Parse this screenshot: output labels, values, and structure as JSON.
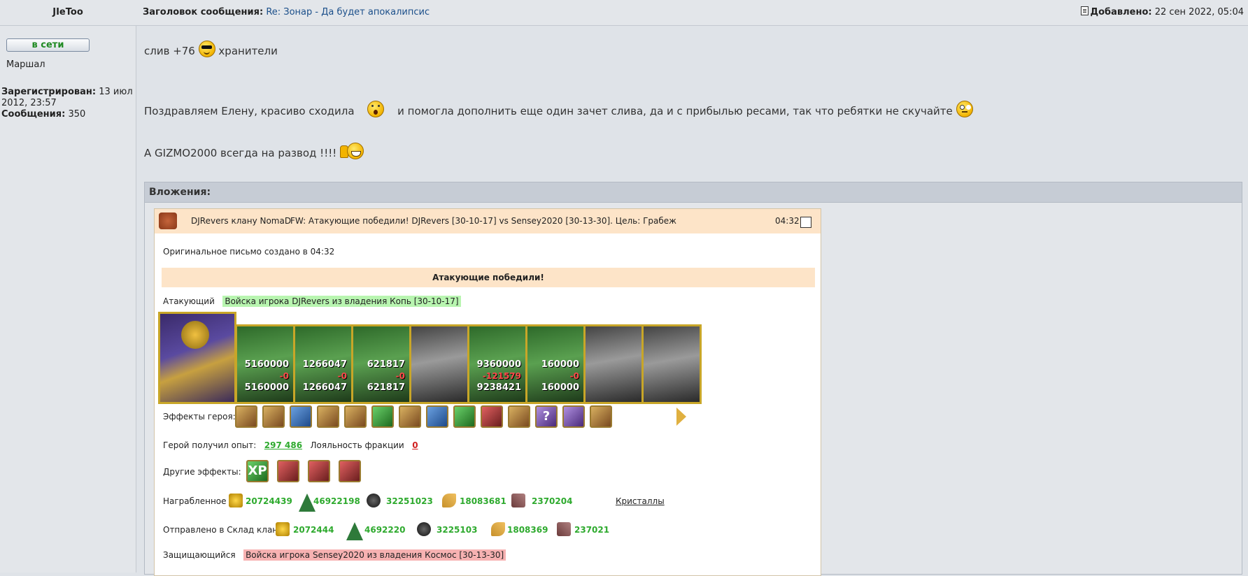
{
  "header": {
    "author": "JIeToo",
    "subject_label": "Заголовок сообщения:",
    "subject": "Re: Зонар - Да будет апокалипсис",
    "added_label": "Добавлено:",
    "added_value": "22 сен 2022, 05:04"
  },
  "sidebar": {
    "online": "в сети",
    "rank": "Маршал",
    "registered_label": "Зарегистрирован:",
    "registered_value": "13 июл 2012, 23:57",
    "posts_label": "Сообщения:",
    "posts_value": "350"
  },
  "post": {
    "line1_a": "слив +76",
    "line1_b": "хранители",
    "line2_a": "Поздравляем Елену, красиво сходила",
    "line2_b": "и помогла дополнить еще один зачет слива, да и с прибылью ресами, так что ребятки не скучайте",
    "line3": "А GIZMO2000 всегда на развод !!!!"
  },
  "attachments": {
    "title": "Вложения:",
    "mail": {
      "from": "DJRevers клану NomaD",
      "subject": "FW: Атакующие победили! DJRevers [30-10-17] vs Sensey2020 [30-13-30]. Цель: Грабеж",
      "time": "04:32",
      "original": "Оригинальное письмо создано в 04:32",
      "banner": "Атакующие победили!",
      "attacker_label": "Атакующий",
      "attacker_value": "Войска игрока DJRevers из владения Копь [30-10-17]",
      "units": [
        {
          "n1": "5160000",
          "n2": "-0",
          "n3": "5160000"
        },
        {
          "n1": "1266047",
          "n2": "-0",
          "n3": "1266047"
        },
        {
          "n1": "621817",
          "n2": "-0",
          "n3": "621817"
        },
        {
          "n1": "",
          "n2": "",
          "n3": ""
        },
        {
          "n1": "9360000",
          "n2": "-121579",
          "n3": "9238421"
        },
        {
          "n1": "160000",
          "n2": "-0",
          "n3": "160000"
        },
        {
          "n1": "",
          "n2": "",
          "n3": ""
        },
        {
          "n1": "",
          "n2": "",
          "n3": ""
        }
      ],
      "hero_effects_label": "Эффекты героя:",
      "hero_effects": [
        "sword-icon",
        "helmet-icon",
        "shield-icon",
        "gauntlet-icon",
        "scroll-icon",
        "blade-icon",
        "handshake-icon",
        "hand-icon",
        "dagger-icon",
        "cross-icon",
        "tower-icon",
        "question-icon",
        "bracelet-icon",
        "fan-icon"
      ],
      "unknown_effect_glyph": "?",
      "xp_label": "Герой получил опыт:",
      "xp_value": "297 486",
      "loyalty_label": "Лояльность фракции",
      "loyalty_value": "0",
      "other_effects_label": "Другие эффекты:",
      "other_effects_xp": "XP",
      "looted_label": "Награбленное",
      "looted": [
        "20724439",
        "46922198",
        "32251023",
        "18083681",
        "2370204"
      ],
      "crystals": "Кристаллы",
      "sent_label": "Отправлено в Склад клана",
      "sent": [
        "2072444",
        "4692220",
        "3225103",
        "1808369",
        "237021"
      ],
      "defender_label": "Защищающийся",
      "defender_value": "Войска игрока Sensey2020 из владения Космос [30-13-30]"
    }
  }
}
